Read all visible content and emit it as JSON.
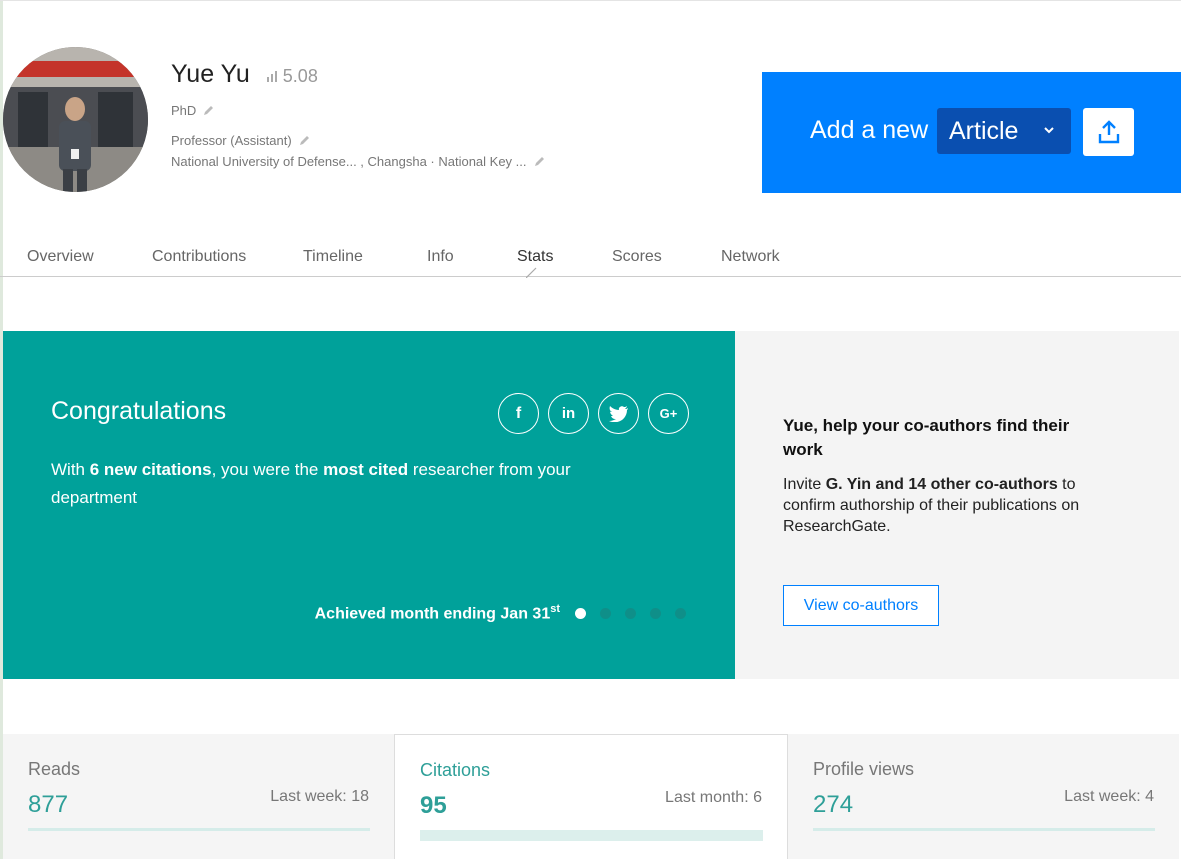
{
  "profile": {
    "name": "Yue Yu",
    "score": "5.08",
    "degree": "PhD",
    "position": "Professor (Assistant)",
    "institution": "National University of Defense... , Changsha · National Key ..."
  },
  "add_banner": {
    "text": "Add a new",
    "selected_type": "Article",
    "upload_icon": "upload-icon",
    "color": "#0080ff"
  },
  "tabs": [
    {
      "label": "Overview"
    },
    {
      "label": "Contributions"
    },
    {
      "label": "Timeline"
    },
    {
      "label": "Info"
    },
    {
      "label": "Stats",
      "active": true
    },
    {
      "label": "Scores"
    },
    {
      "label": "Network"
    }
  ],
  "congrats": {
    "title": "Congratulations",
    "message_prefix": "With ",
    "message_bold1": "6 new citations",
    "message_mid": ", you were the ",
    "message_bold2": "most cited",
    "message_suffix": " researcher from your department",
    "achieved": "Achieved month ending Jan 31",
    "achieved_sup": "st",
    "social": [
      {
        "icon": "facebook-icon",
        "glyph": "f"
      },
      {
        "icon": "linkedin-icon",
        "glyph": "in"
      },
      {
        "icon": "twitter-icon",
        "glyph": "🐦"
      },
      {
        "icon": "google-plus-icon",
        "glyph": "G+"
      }
    ],
    "color": "#00a19a"
  },
  "coauthors": {
    "title": "Yue, help your co-authors find their work",
    "body_prefix": "Invite ",
    "body_bold": "G. Yin and 14 other co-authors",
    "body_suffix": " to confirm authorship of their publications on ResearchGate.",
    "button": "View co-authors"
  },
  "stats": [
    {
      "label": "Reads",
      "value": "877",
      "sub": "Last week: 18"
    },
    {
      "label": "Citations",
      "value": "95",
      "sub": "Last month: 6"
    },
    {
      "label": "Profile views",
      "value": "274",
      "sub": "Last week: 4"
    }
  ]
}
